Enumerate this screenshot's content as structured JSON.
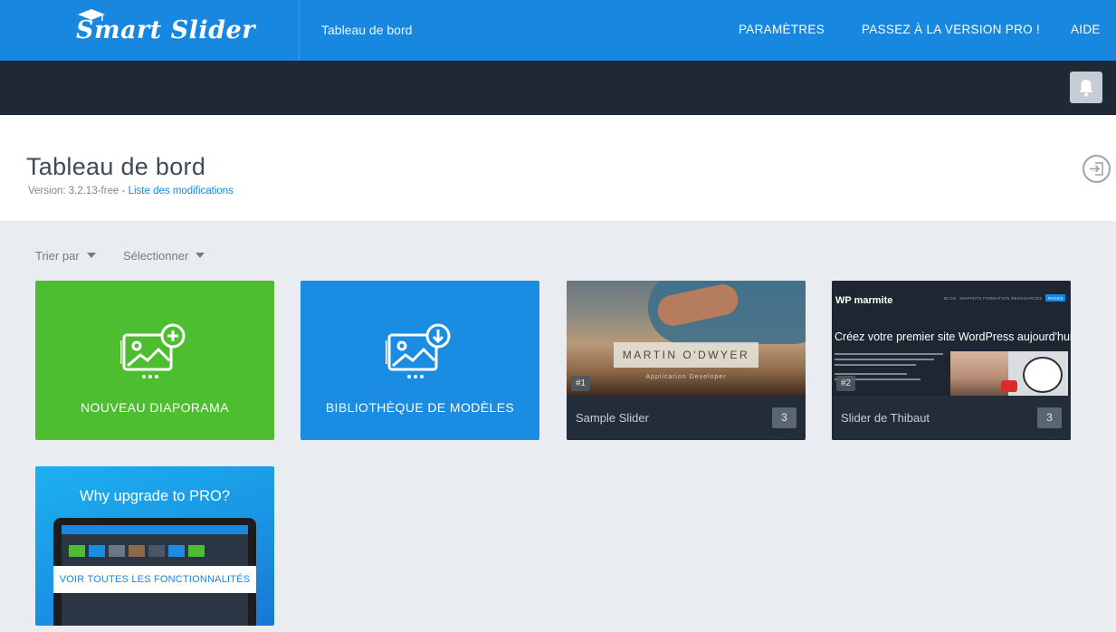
{
  "header": {
    "logo_text": "Smart Slider",
    "breadcrumb": "Tableau de bord",
    "nav": {
      "settings": "PARAMÈTRES",
      "pro": "PASSEZ À LA VERSION PRO !",
      "help": "AIDE"
    }
  },
  "page": {
    "title": "Tableau de bord",
    "version_text": "Version: 3.2.13-free - ",
    "changelog_link": "Liste des modifications"
  },
  "filters": {
    "sort_by": "Trier par",
    "select": "Sélectionner"
  },
  "actions": {
    "new_slider": "NOUVEAU DIAPORAMA",
    "template_library": "BIBLIOTHÈQUE DE MODÈLES"
  },
  "sliders": [
    {
      "id_label": "#1",
      "name": "Sample Slider",
      "count": "3",
      "thumb_title": "MARTIN O'DWYER",
      "thumb_subtitle": "Application Developer"
    },
    {
      "id_label": "#2",
      "name": "Slider de Thibaut",
      "count": "3",
      "thumb_logo": "WP marmite",
      "thumb_nav": [
        "BLOG",
        "SNIPPETS",
        "FORMATION",
        "RESSOURCES",
        "PAGES"
      ],
      "thumb_headline": "Créez votre premier site WordPress aujourd'hui"
    }
  ],
  "upgrade": {
    "title": "Why upgrade to PRO?",
    "button": "VOIR TOUTES LES FONCTIONNALITÉS"
  },
  "colors": {
    "header_blue": "#1787e0",
    "toolbar_dark": "#1f2835",
    "new_slider_green": "#4cbe2f",
    "library_blue": "#1a8ce2",
    "card_footer": "#232d3a"
  },
  "icons": {
    "bell": "bell-icon",
    "exit": "exit-icon",
    "image_add": "image-add-icon",
    "image_download": "image-download-icon"
  }
}
